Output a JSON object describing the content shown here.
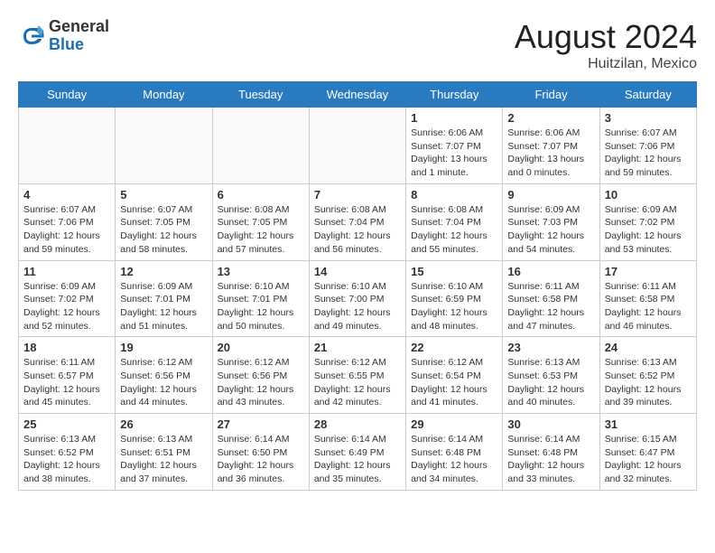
{
  "header": {
    "logo_general": "General",
    "logo_blue": "Blue",
    "month_year": "August 2024",
    "location": "Huitzilan, Mexico"
  },
  "days_of_week": [
    "Sunday",
    "Monday",
    "Tuesday",
    "Wednesday",
    "Thursday",
    "Friday",
    "Saturday"
  ],
  "weeks": [
    [
      {
        "day": "",
        "info": ""
      },
      {
        "day": "",
        "info": ""
      },
      {
        "day": "",
        "info": ""
      },
      {
        "day": "",
        "info": ""
      },
      {
        "day": "1",
        "info": "Sunrise: 6:06 AM\nSunset: 7:07 PM\nDaylight: 13 hours\nand 1 minute."
      },
      {
        "day": "2",
        "info": "Sunrise: 6:06 AM\nSunset: 7:07 PM\nDaylight: 13 hours\nand 0 minutes."
      },
      {
        "day": "3",
        "info": "Sunrise: 6:07 AM\nSunset: 7:06 PM\nDaylight: 12 hours\nand 59 minutes."
      }
    ],
    [
      {
        "day": "4",
        "info": "Sunrise: 6:07 AM\nSunset: 7:06 PM\nDaylight: 12 hours\nand 59 minutes."
      },
      {
        "day": "5",
        "info": "Sunrise: 6:07 AM\nSunset: 7:05 PM\nDaylight: 12 hours\nand 58 minutes."
      },
      {
        "day": "6",
        "info": "Sunrise: 6:08 AM\nSunset: 7:05 PM\nDaylight: 12 hours\nand 57 minutes."
      },
      {
        "day": "7",
        "info": "Sunrise: 6:08 AM\nSunset: 7:04 PM\nDaylight: 12 hours\nand 56 minutes."
      },
      {
        "day": "8",
        "info": "Sunrise: 6:08 AM\nSunset: 7:04 PM\nDaylight: 12 hours\nand 55 minutes."
      },
      {
        "day": "9",
        "info": "Sunrise: 6:09 AM\nSunset: 7:03 PM\nDaylight: 12 hours\nand 54 minutes."
      },
      {
        "day": "10",
        "info": "Sunrise: 6:09 AM\nSunset: 7:02 PM\nDaylight: 12 hours\nand 53 minutes."
      }
    ],
    [
      {
        "day": "11",
        "info": "Sunrise: 6:09 AM\nSunset: 7:02 PM\nDaylight: 12 hours\nand 52 minutes."
      },
      {
        "day": "12",
        "info": "Sunrise: 6:09 AM\nSunset: 7:01 PM\nDaylight: 12 hours\nand 51 minutes."
      },
      {
        "day": "13",
        "info": "Sunrise: 6:10 AM\nSunset: 7:01 PM\nDaylight: 12 hours\nand 50 minutes."
      },
      {
        "day": "14",
        "info": "Sunrise: 6:10 AM\nSunset: 7:00 PM\nDaylight: 12 hours\nand 49 minutes."
      },
      {
        "day": "15",
        "info": "Sunrise: 6:10 AM\nSunset: 6:59 PM\nDaylight: 12 hours\nand 48 minutes."
      },
      {
        "day": "16",
        "info": "Sunrise: 6:11 AM\nSunset: 6:58 PM\nDaylight: 12 hours\nand 47 minutes."
      },
      {
        "day": "17",
        "info": "Sunrise: 6:11 AM\nSunset: 6:58 PM\nDaylight: 12 hours\nand 46 minutes."
      }
    ],
    [
      {
        "day": "18",
        "info": "Sunrise: 6:11 AM\nSunset: 6:57 PM\nDaylight: 12 hours\nand 45 minutes."
      },
      {
        "day": "19",
        "info": "Sunrise: 6:12 AM\nSunset: 6:56 PM\nDaylight: 12 hours\nand 44 minutes."
      },
      {
        "day": "20",
        "info": "Sunrise: 6:12 AM\nSunset: 6:56 PM\nDaylight: 12 hours\nand 43 minutes."
      },
      {
        "day": "21",
        "info": "Sunrise: 6:12 AM\nSunset: 6:55 PM\nDaylight: 12 hours\nand 42 minutes."
      },
      {
        "day": "22",
        "info": "Sunrise: 6:12 AM\nSunset: 6:54 PM\nDaylight: 12 hours\nand 41 minutes."
      },
      {
        "day": "23",
        "info": "Sunrise: 6:13 AM\nSunset: 6:53 PM\nDaylight: 12 hours\nand 40 minutes."
      },
      {
        "day": "24",
        "info": "Sunrise: 6:13 AM\nSunset: 6:52 PM\nDaylight: 12 hours\nand 39 minutes."
      }
    ],
    [
      {
        "day": "25",
        "info": "Sunrise: 6:13 AM\nSunset: 6:52 PM\nDaylight: 12 hours\nand 38 minutes."
      },
      {
        "day": "26",
        "info": "Sunrise: 6:13 AM\nSunset: 6:51 PM\nDaylight: 12 hours\nand 37 minutes."
      },
      {
        "day": "27",
        "info": "Sunrise: 6:14 AM\nSunset: 6:50 PM\nDaylight: 12 hours\nand 36 minutes."
      },
      {
        "day": "28",
        "info": "Sunrise: 6:14 AM\nSunset: 6:49 PM\nDaylight: 12 hours\nand 35 minutes."
      },
      {
        "day": "29",
        "info": "Sunrise: 6:14 AM\nSunset: 6:48 PM\nDaylight: 12 hours\nand 34 minutes."
      },
      {
        "day": "30",
        "info": "Sunrise: 6:14 AM\nSunset: 6:48 PM\nDaylight: 12 hours\nand 33 minutes."
      },
      {
        "day": "31",
        "info": "Sunrise: 6:15 AM\nSunset: 6:47 PM\nDaylight: 12 hours\nand 32 minutes."
      }
    ]
  ]
}
